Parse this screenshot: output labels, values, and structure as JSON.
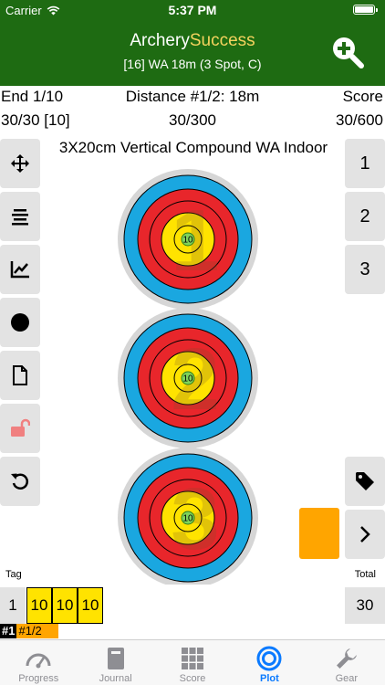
{
  "status_bar": {
    "carrier": "Carrier",
    "time": "5:37 PM"
  },
  "nav": {
    "title_part1": "Archery",
    "title_part2": "Success",
    "subtitle": "[16] WA 18m (3 Spot, C)",
    "icons": {
      "zoom": "zoom-in-icon"
    }
  },
  "header": {
    "end": "End 1/10",
    "distance": "Distance #1/2: 18m",
    "score_label": "Score",
    "end_score": "30/30 [10]",
    "distance_score": "30/300",
    "total_score": "30/600"
  },
  "target": {
    "title": "3X20cm Vertical Compound WA Indoor",
    "spots": [
      {
        "arrow": "1",
        "value": "10"
      },
      {
        "arrow": "2",
        "value": "10"
      },
      {
        "arrow": "3",
        "value": "10"
      }
    ]
  },
  "tools": [
    "move-icon",
    "align-icon",
    "chart-icon",
    "dot-icon",
    "document-icon",
    "unlock-icon",
    "undo-icon"
  ],
  "end_buttons": [
    "1",
    "2",
    "3"
  ],
  "tag_label": "Tag",
  "total_label": "Total",
  "scores": {
    "end_number": "1",
    "arrows": [
      "10",
      "10",
      "10"
    ],
    "total": "30"
  },
  "end_tag": {
    "number": "#1",
    "distance": "#1/2"
  },
  "colors": {
    "brand": "#1e6b12",
    "accent": "#f4d35e",
    "swatch": "#ffa500",
    "tab_active": "#0a7aff"
  },
  "tabs": [
    {
      "label": "Progress",
      "icon": "gauge-icon"
    },
    {
      "label": "Journal",
      "icon": "book-icon"
    },
    {
      "label": "Score",
      "icon": "grid-icon"
    },
    {
      "label": "Plot",
      "icon": "target-icon",
      "active": true
    },
    {
      "label": "Gear",
      "icon": "wrench-icon"
    }
  ]
}
